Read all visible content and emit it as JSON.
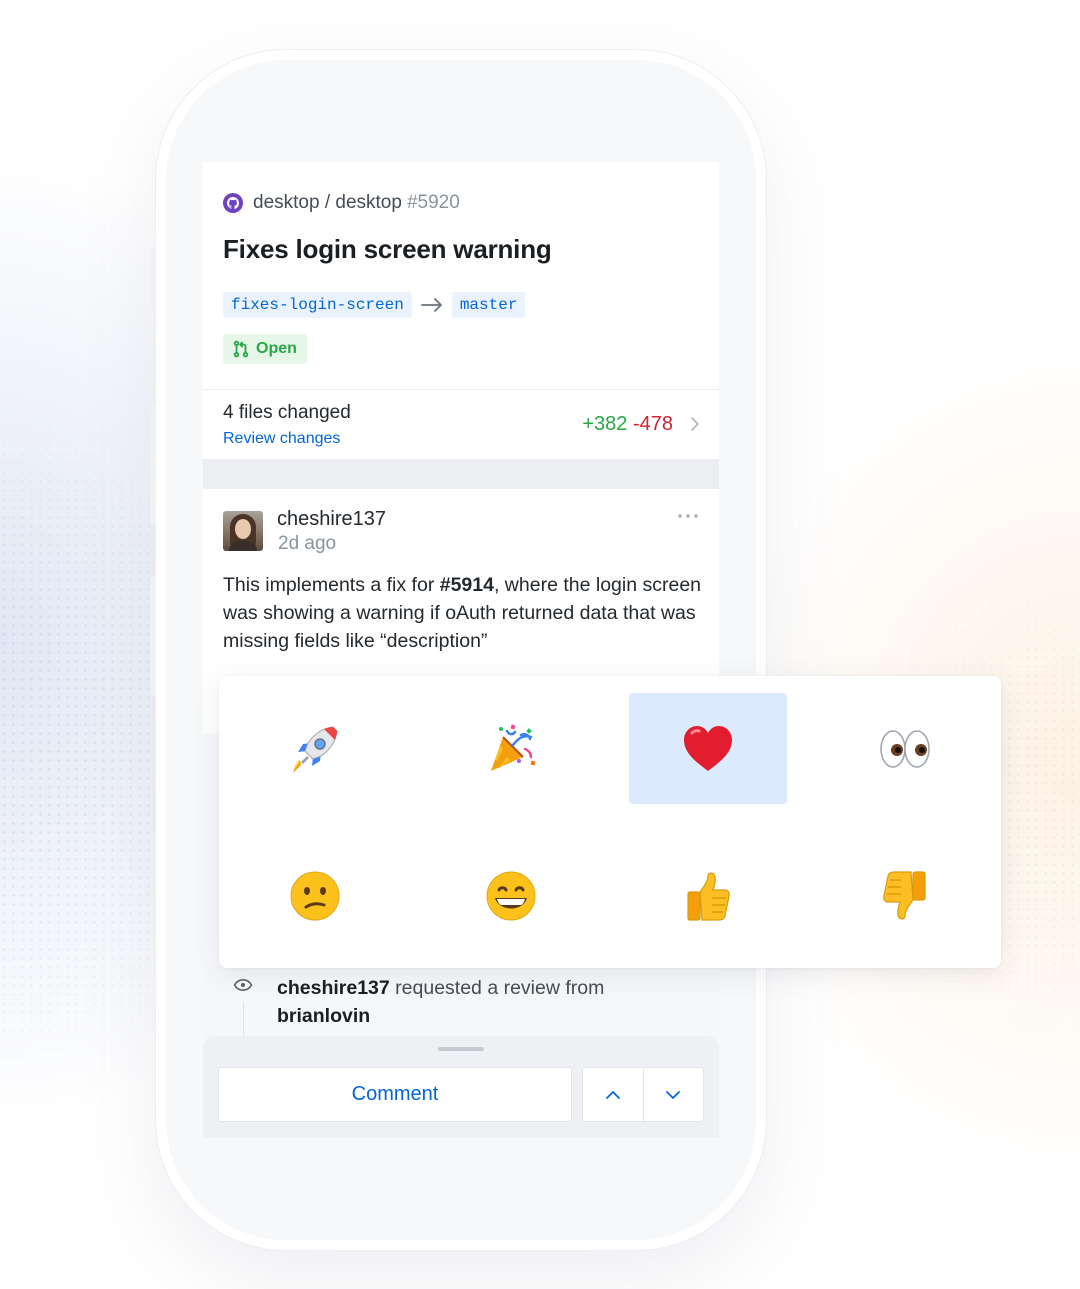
{
  "pr": {
    "repo": "desktop / desktop",
    "number": "#5920",
    "title": "Fixes login screen warning",
    "head_branch": "fixes-login-screen",
    "base_branch": "master",
    "status": "Open"
  },
  "files": {
    "title": "4 files changed",
    "link": "Review changes",
    "additions": "+382",
    "deletions": "-478"
  },
  "comment": {
    "author": "cheshire137",
    "time": "2d ago",
    "body_prefix": "This implements a fix for ",
    "issue_ref": "#5914",
    "body_suffix": ", where the login screen was showing a warning if oAuth returned data that was missing fields like “description”"
  },
  "reactions": {
    "items": [
      "rocket",
      "party-popper",
      "heart",
      "eyes",
      "confused",
      "grinning",
      "thumbs-up",
      "thumbs-down"
    ],
    "selected": "heart"
  },
  "timeline": {
    "actor": "cheshire137",
    "action": " requested a review from ",
    "target": "brianlovin"
  },
  "bottom_bar": {
    "comment_label": "Comment"
  },
  "colors": {
    "link": "#0366d6",
    "additions": "#28a745",
    "deletions": "#cb2431",
    "open_badge_bg": "#e6f7ea",
    "selected_reaction_bg": "#dbeafd"
  }
}
